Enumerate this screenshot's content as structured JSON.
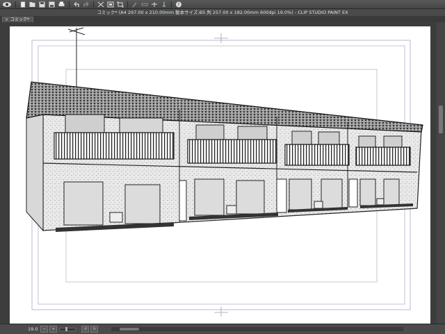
{
  "window": {
    "title": "コミック* (A4 297.00 x 210.00mm 製本サイズ:B5 判 257.00 x 182.00mm 600dpi 19.0%)  - CLIP STUDIO PAINT EX"
  },
  "tab": {
    "label": "コミック*",
    "close_glyph": "×"
  },
  "toolbar": {
    "icons": [
      "eye-icon",
      "new-file-icon",
      "open-file-icon",
      "save-icon",
      "save-as-icon",
      "print-icon",
      "undo-icon",
      "redo-icon",
      "clear-icon",
      "fill-icon",
      "transform-icon",
      "brush-icon",
      "ruler-icon",
      "snap-icon",
      "pen-icon",
      "help-icon"
    ]
  },
  "status": {
    "zoom": "19.0",
    "rotation_buttons": [
      "↺",
      "↻"
    ]
  },
  "colors": {
    "ui_dark": "#3d3d3d",
    "canvas_bg": "#ffffff",
    "frame_line": "#9a9ab4"
  }
}
